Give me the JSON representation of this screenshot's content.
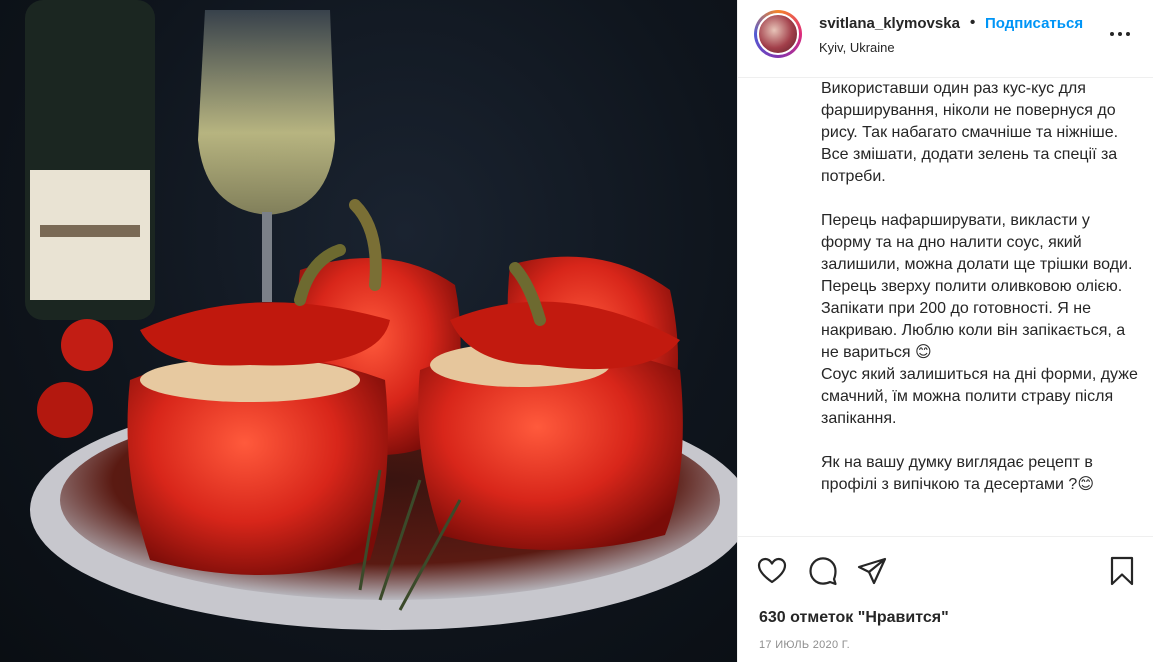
{
  "post": {
    "photo_alt": "stuffed red peppers on a plate"
  },
  "header": {
    "username": "svitlana_klymovska",
    "separator": "•",
    "follow_label": "Подписаться",
    "location": "Kyiv, Ukraine"
  },
  "caption": {
    "text": "Використавши один раз кус-кус для фарширування, ніколи не повернуся до рису. Так набагато смачніше та ніжніше.\nВсе змішати, додати зелень та спеції за потреби.\n\nПерець нафарширувати, викласти у форму та на дно налити соус, який залишили, можна долати ще трішки води. Перець зверху полити оливковою олією.\nЗапікати при 200 до готовності. Я не накриваю. Люблю коли він запікається, а не вариться 😊\nСоус який залишиться на дні форми, дуже смачний, їм можна полити страву після запікання.\n\nЯк на вашу думку виглядає рецепт в профілі з випічкою та десертами ?😊"
  },
  "actions": {
    "like_icon": "heart-icon",
    "comment_icon": "comment-icon",
    "share_icon": "send-icon",
    "save_icon": "bookmark-icon"
  },
  "stats": {
    "likes_text": "630 отметок \"Нравится\"",
    "date_text": "17 ИЮЛЬ 2020 Г."
  },
  "colors": {
    "accent": "#0095f6",
    "text": "#262626",
    "muted": "#8e8e8e",
    "border": "#efefef"
  }
}
